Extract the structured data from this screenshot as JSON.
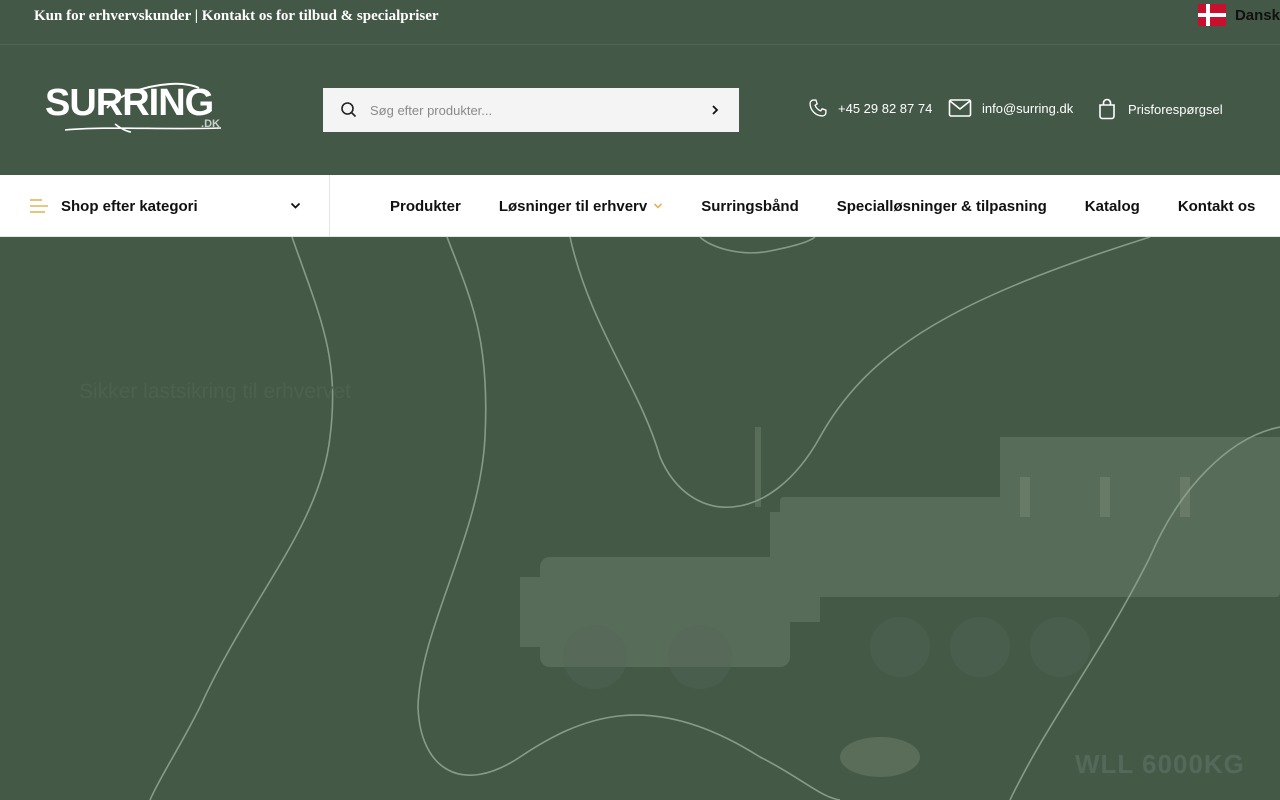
{
  "topbar": {
    "notice": "Kun for erhvervskunder | Kontakt os for tilbud & specialpriser",
    "language": "Dansk"
  },
  "header": {
    "logo_text": "SURRING",
    "logo_sub": ".DK",
    "search_placeholder": "Søg efter produkter...",
    "phone": "+45 29 82 87 74",
    "email": "info@surring.dk",
    "quote_label": "Prisforespørgsel"
  },
  "nav": {
    "category_label": "Shop efter kategori",
    "items": [
      {
        "label": "Produkter"
      },
      {
        "label": "Løsninger til erhverv"
      },
      {
        "label": "Surringsbånd"
      },
      {
        "label": "Specialløsninger & tilpasning"
      },
      {
        "label": "Katalog"
      },
      {
        "label": "Kontakt os"
      }
    ]
  },
  "hero": {
    "faded_heading": "Sikker lastsikring til erhvervet",
    "faded_tag": "WLL 6000KG"
  },
  "colors": {
    "brand_green": "#435846",
    "accent_gold": "#e1b45a",
    "nav_bg": "#ffffff"
  }
}
